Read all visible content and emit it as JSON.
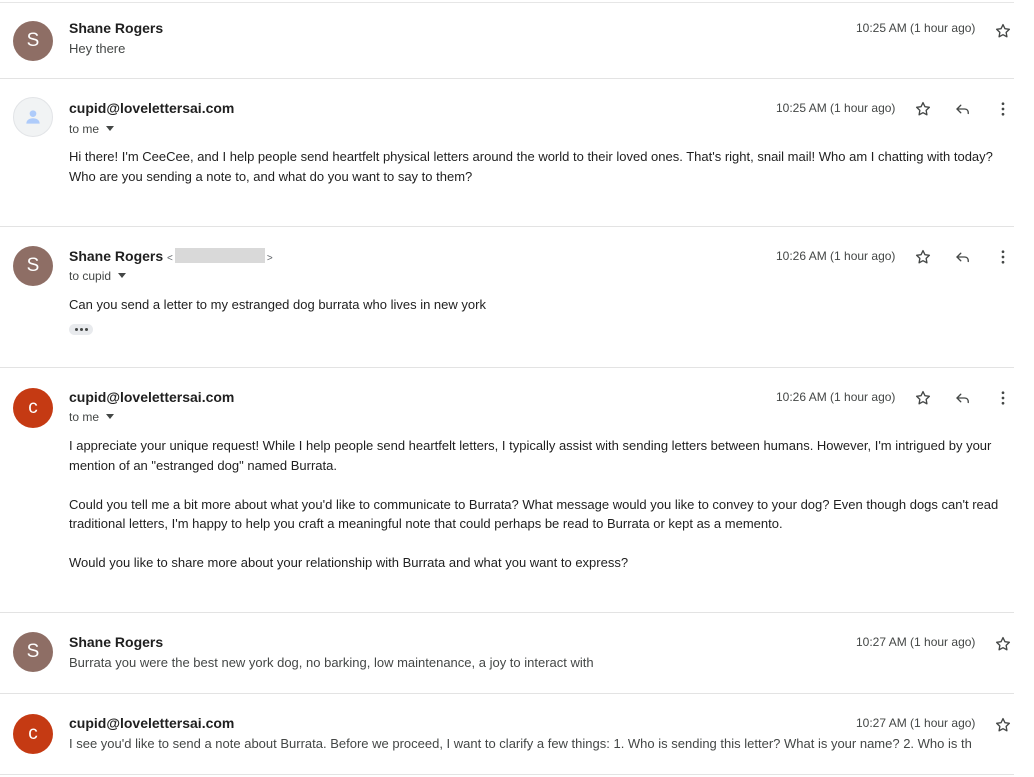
{
  "messages": [
    {
      "avatar_letter": "S",
      "sender": "Shane Rogers",
      "snippet": "Hey there",
      "time": "10:25 AM (1 hour ago)"
    },
    {
      "sender": "cupid@lovelettersai.com",
      "recipient": "to me",
      "time": "10:25 AM (1 hour ago)",
      "body": [
        "Hi there! I'm CeeCee, and I help people send heartfelt physical letters around the world to their loved ones. That's right, snail mail! Who am I chatting with today? Who are you sending a note to, and what do you want to say to them?"
      ]
    },
    {
      "avatar_letter": "S",
      "sender": "Shane Rogers",
      "email_open": "<",
      "email_close": ">",
      "recipient": "to cupid",
      "time": "10:26 AM (1 hour ago)",
      "body": [
        "Can you send a letter to my estranged dog burrata who lives in new york"
      ]
    },
    {
      "avatar_letter": "c",
      "sender": "cupid@lovelettersai.com",
      "recipient": "to me",
      "time": "10:26 AM (1 hour ago)",
      "body": [
        "I appreciate your unique request! While I help people send heartfelt letters, I typically assist with sending letters between humans. However, I'm intrigued by your mention of an \"estranged dog\" named Burrata.",
        "Could you tell me a bit more about what you'd like to communicate to Burrata? What message would you like to convey to your dog? Even though dogs can't read traditional letters, I'm happy to help you craft a meaningful note that could perhaps be read to Burrata or kept as a memento.",
        "Would you like to share more about your relationship with Burrata and what you want to express?"
      ]
    },
    {
      "avatar_letter": "S",
      "sender": "Shane Rogers",
      "snippet": "Burrata you were the best new york dog, no barking, low maintenance, a joy to interact with",
      "time": "10:27 AM (1 hour ago)"
    },
    {
      "avatar_letter": "c",
      "sender": "cupid@lovelettersai.com",
      "snippet": "I see you'd like to send a note about Burrata. Before we proceed, I want to clarify a few things: 1. Who is sending this letter? What is your name? 2. Who is th",
      "time": "10:27 AM (1 hour ago)"
    }
  ],
  "icons": {
    "star": "star-icon",
    "reply": "reply-icon",
    "more": "more-vert-icon",
    "expand": "more-horiz-icon",
    "caret": "caret-down-icon",
    "person": "person-icon"
  },
  "colors": {
    "avatar_shane": "#8e6e65",
    "avatar_cupid": "#c53a13",
    "avatar_placeholder": "#f1f3f4",
    "person_icon": "#aecbfa"
  }
}
